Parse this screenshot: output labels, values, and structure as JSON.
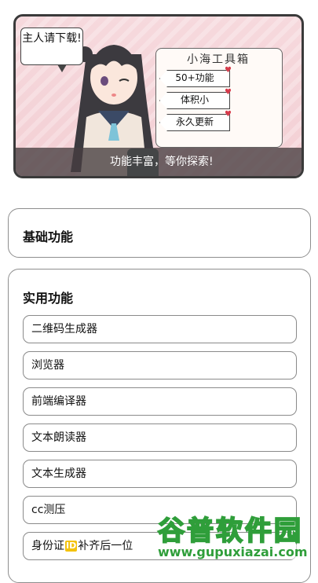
{
  "banner": {
    "speech": "主人请下载!",
    "card_title": "小海工具箱",
    "tags": [
      "50+功能",
      "体积小",
      "永久更新"
    ],
    "caption": "功能丰富，等你探索!"
  },
  "basic_section": {
    "title": "基础功能"
  },
  "practical_section": {
    "title": "实用功能",
    "items": [
      {
        "label": "二维码生成器"
      },
      {
        "label": "浏览器"
      },
      {
        "label": "前端编译器"
      },
      {
        "label": "文本朗读器"
      },
      {
        "label": "文本生成器"
      },
      {
        "label": "cc测压"
      },
      {
        "label_pre": "身份证",
        "badge": "ID",
        "label_post": "补齐后一位"
      }
    ]
  },
  "watermark": {
    "title": "谷普软件园",
    "url": "www.gupuxiazai.com",
    "color": "#2f9e3a"
  }
}
